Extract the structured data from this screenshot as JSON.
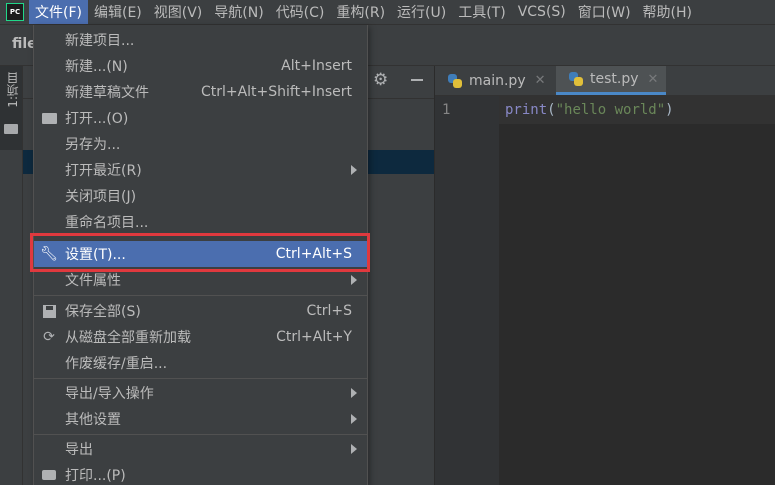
{
  "menubar": {
    "app_icon_text": "PC",
    "items": [
      {
        "label": "文件(F)",
        "active": true
      },
      {
        "label": "编辑(E)"
      },
      {
        "label": "视图(V)"
      },
      {
        "label": "导航(N)"
      },
      {
        "label": "代码(C)"
      },
      {
        "label": "重构(R)"
      },
      {
        "label": "运行(U)"
      },
      {
        "label": "工具(T)"
      },
      {
        "label": "VCS(S)"
      },
      {
        "label": "窗口(W)"
      },
      {
        "label": "帮助(H)"
      }
    ]
  },
  "navbar": {
    "file_label": "file"
  },
  "tool_strip": {
    "project_tab_label": "1:项目"
  },
  "editor": {
    "tabs": [
      {
        "label": "main.py",
        "active": false
      },
      {
        "label": "test.py",
        "active": true
      }
    ],
    "line_number": "1",
    "code": {
      "fn": "print",
      "open": "(",
      "str": "\"hello world\"",
      "close": ")"
    }
  },
  "file_menu": {
    "items": [
      {
        "label": "新建项目...",
        "shortcut": ""
      },
      {
        "label": "新建...(N)",
        "shortcut": "Alt+Insert"
      },
      {
        "label": "新建草稿文件",
        "shortcut": "Ctrl+Alt+Shift+Insert"
      },
      {
        "label": "打开...(O)",
        "shortcut": "",
        "icon": "folder-open-icon"
      },
      {
        "label": "另存为...",
        "shortcut": ""
      },
      {
        "label": "打开最近(R)",
        "shortcut": "",
        "submenu": true
      },
      {
        "label": "关闭项目(J)",
        "shortcut": ""
      },
      {
        "label": "重命名项目...",
        "shortcut": ""
      },
      {
        "label": "设置(T)...",
        "shortcut": "Ctrl+Alt+S",
        "icon": "wrench-icon",
        "highlighted": true
      },
      {
        "label": "文件属性",
        "shortcut": "",
        "submenu": true
      },
      {
        "label": "保存全部(S)",
        "shortcut": "Ctrl+S",
        "icon": "save-icon"
      },
      {
        "label": "从磁盘全部重新加载",
        "shortcut": "Ctrl+Alt+Y",
        "icon": "reload-icon"
      },
      {
        "label": "作废缓存/重启...",
        "shortcut": ""
      },
      {
        "label": "导出/导入操作",
        "shortcut": "",
        "submenu": true
      },
      {
        "label": "其他设置",
        "shortcut": "",
        "submenu": true
      },
      {
        "label": "导出",
        "shortcut": "",
        "submenu": true
      },
      {
        "label": "打印...(P)",
        "shortcut": "",
        "icon": "print-icon"
      }
    ]
  },
  "colors": {
    "menu_highlight": "#4b6eaf",
    "annotation_box": "#e0393e",
    "tab_underline": "#4a88c7",
    "string": "#6a8759"
  }
}
